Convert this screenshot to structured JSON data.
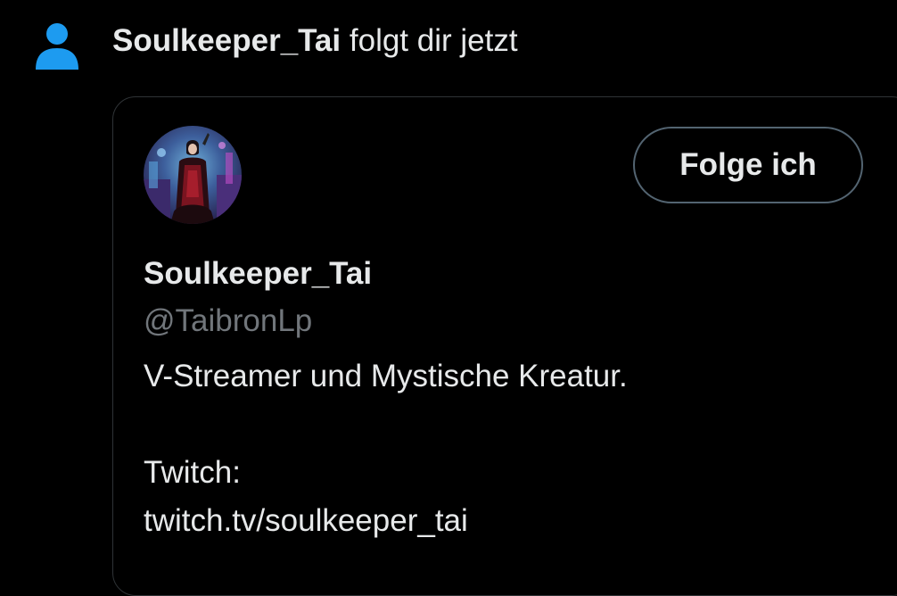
{
  "notification": {
    "icon": "person-icon",
    "icon_color": "#1d9bf0",
    "user_name": "Soulkeeper_Tai",
    "action_text": "folgt dir jetzt"
  },
  "profile_card": {
    "avatar": "profile-avatar-image",
    "follow_button_label": "Folge ich",
    "display_name": "Soulkeeper_Tai",
    "handle": "@TaibronLp",
    "bio": {
      "line1": "V-Streamer und Mystische Kreatur.",
      "line2": "Twitch:",
      "line3": "twitch.tv/soulkeeper_tai"
    }
  },
  "colors": {
    "background": "#000000",
    "text_primary": "#e7e9ea",
    "text_secondary": "#71767b",
    "card_border": "#2f3336",
    "button_border": "#536471"
  }
}
